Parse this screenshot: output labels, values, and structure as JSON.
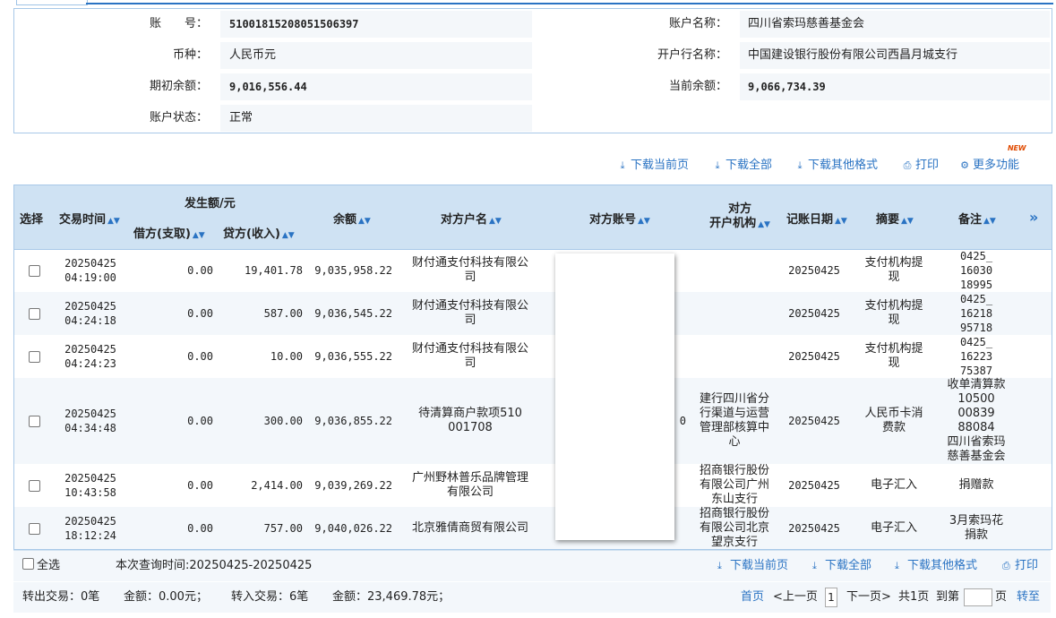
{
  "account": {
    "no_label": "账　　号：",
    "no_value": "51001815208051506397",
    "name_label": "账户名称：",
    "name_value": "四川省索玛慈善基金会",
    "currency_label": "币种：",
    "currency_value": "人民币元",
    "bank_label": "开户行名称：",
    "bank_value": "中国建设银行股份有限公司西昌月城支行",
    "opening_label": "期初余额：",
    "opening_value": "9,016,556.44",
    "current_label": "当前余额：",
    "current_value": "9,066,734.39",
    "status_label": "账户状态：",
    "status_value": "正常"
  },
  "toolbar": {
    "new_badge": "NEW",
    "download_current": "下载当前页",
    "download_all": "下载全部",
    "download_other": "下载其他格式",
    "print": "打印",
    "more": "更多功能"
  },
  "table_header": {
    "select": "选择",
    "time": "交易时间",
    "amount_group": "发生额/元",
    "debit": "借方(支取)",
    "credit": "贷方(收入)",
    "balance": "余额",
    "counterparty": "对方户名",
    "counter_account": "对方账号",
    "counter_bank_1": "对方",
    "counter_bank_2": "开户机构",
    "post_date": "记账日期",
    "summary": "摘要",
    "remark": "备注",
    "more_cols": "»"
  },
  "rows": [
    {
      "date": "20250425",
      "time": "04:19:00",
      "debit": "0.00",
      "credit": "19,401.78",
      "balance": "9,035,958.22",
      "cp1": "财付通支付科技有限公",
      "cp2": "司",
      "bank": [],
      "post": "20250425",
      "sum1": "支付机构提",
      "sum2": "现",
      "remark": [
        "0425_",
        "16030",
        "18995"
      ],
      "acct_tail": ""
    },
    {
      "date": "20250425",
      "time": "04:24:18",
      "debit": "0.00",
      "credit": "587.00",
      "balance": "9,036,545.22",
      "cp1": "财付通支付科技有限公",
      "cp2": "司",
      "bank": [],
      "post": "20250425",
      "sum1": "支付机构提",
      "sum2": "现",
      "remark": [
        "0425_",
        "16218",
        "95718"
      ],
      "acct_tail": ""
    },
    {
      "date": "20250425",
      "time": "04:24:23",
      "debit": "0.00",
      "credit": "10.00",
      "balance": "9,036,555.22",
      "cp1": "财付通支付科技有限公",
      "cp2": "司",
      "bank": [],
      "post": "20250425",
      "sum1": "支付机构提",
      "sum2": "现",
      "remark": [
        "0425_",
        "16223",
        "75387"
      ],
      "acct_tail": ""
    },
    {
      "date": "20250425",
      "time": "04:34:48",
      "debit": "0.00",
      "credit": "300.00",
      "balance": "9,036,855.22",
      "cp1": "待清算商户款项510",
      "cp2": "001708",
      "bank": [
        "建行四川省分",
        "行渠道与运营",
        "管理部核算中",
        "心"
      ],
      "post": "20250425",
      "sum1": "人民币卡消",
      "sum2": "费款",
      "remark": [
        "收单清算款",
        "10500",
        "00839",
        "88084",
        "四川省索玛",
        "慈善基金会"
      ],
      "acct_tail": "0"
    },
    {
      "date": "20250425",
      "time": "10:43:58",
      "debit": "0.00",
      "credit": "2,414.00",
      "balance": "9,039,269.22",
      "cp1": "广州野林普乐品牌管理",
      "cp2": "有限公司",
      "bank": [
        "招商银行股份",
        "有限公司广州",
        "东山支行"
      ],
      "post": "20250425",
      "sum1": "电子汇入",
      "sum2": "",
      "remark": [
        "捐赠款"
      ],
      "acct_tail": ""
    },
    {
      "date": "20250425",
      "time": "18:12:24",
      "debit": "0.00",
      "credit": "757.00",
      "balance": "9,040,026.22",
      "cp1": "北京雅倩商贸有限公司",
      "cp2": "",
      "bank": [
        "招商银行股份",
        "有限公司北京",
        "望京支行"
      ],
      "post": "20250425",
      "sum1": "电子汇入",
      "sum2": "",
      "remark": [
        "3月索玛花",
        "捐款"
      ],
      "acct_tail": ""
    }
  ],
  "footer": {
    "select_all": "全选",
    "query_time": "本次查询时间:20250425-20250425",
    "download_current": "下载当前页",
    "download_all": "下载全部",
    "download_other": "下载其他格式",
    "print": "打印",
    "out_summary": "转出交易：0笔",
    "out_amount": "金额：0.00元；",
    "in_summary": "转入交易：6笔",
    "in_amount": "金额：23,469.78元；",
    "first_page": "首页",
    "prev_page": "<上一页",
    "page_no": "1",
    "next_page": "下一页>",
    "total_pages": "共1页",
    "goto_label": "到第",
    "page_unit": "页",
    "goto_button": "转至"
  },
  "colors": {
    "accent": "#2a73c3",
    "header_bg": "#cfe2f3",
    "border": "#a8c8e8",
    "new_badge": "#e04a00"
  }
}
